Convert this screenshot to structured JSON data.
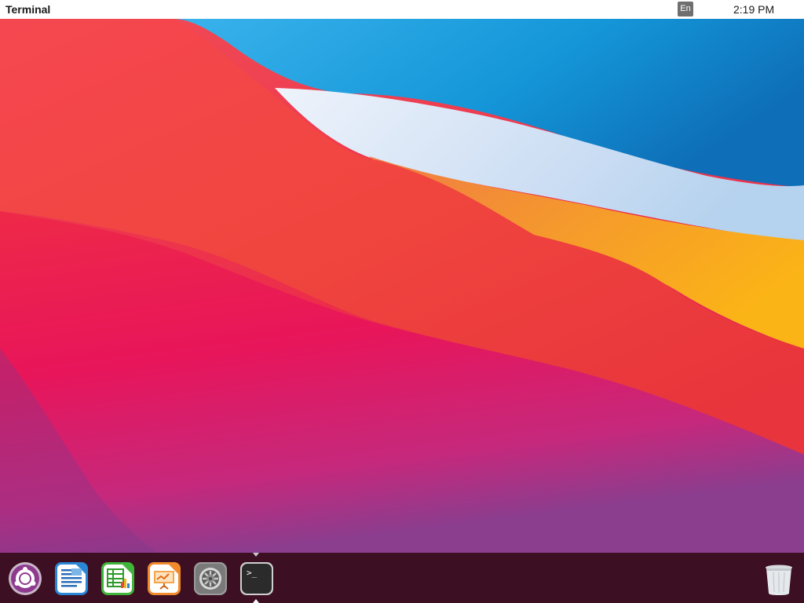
{
  "topbar": {
    "app_title": "Terminal",
    "language": "En",
    "clock": "2:19 PM"
  },
  "dock": {
    "items": [
      {
        "name": "Ubuntu app launcher",
        "icon": "ubuntu-launcher-icon"
      },
      {
        "name": "LibreOffice Writer",
        "icon": "document-writer-icon"
      },
      {
        "name": "LibreOffice Calc",
        "icon": "spreadsheet-calc-icon"
      },
      {
        "name": "LibreOffice Impress",
        "icon": "presentation-impress-icon"
      },
      {
        "name": "Settings",
        "icon": "settings-gear-icon"
      },
      {
        "name": "Terminal",
        "icon": "terminal-icon",
        "running": true
      }
    ],
    "trash_icon": "trash-icon",
    "terminal_prompt": ">_"
  },
  "colors": {
    "topbar_bg": "#ffffff",
    "dock_bg": "#3d0f22",
    "wallpaper_red": "#ef2f49",
    "wallpaper_blue": "#1a8fd6",
    "wallpaper_orange": "#f6a623",
    "wallpaper_magenta": "#d92a7a"
  }
}
